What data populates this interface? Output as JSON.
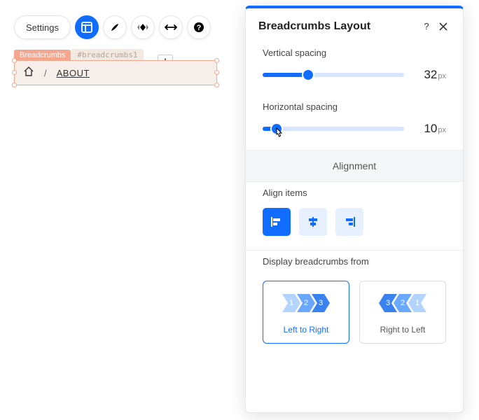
{
  "toolbar": {
    "settings_label": "Settings"
  },
  "element": {
    "badge_name": "Breadcrumbs",
    "badge_id": "#breadcrumbs1",
    "separator": "/",
    "current_label": "ABOUT"
  },
  "panel": {
    "title": "Breadcrumbs Layout",
    "vertical_spacing": {
      "label": "Vertical spacing",
      "value": "32",
      "unit": "px",
      "percent": 32
    },
    "horizontal_spacing": {
      "label": "Horizontal spacing",
      "value": "10",
      "unit": "px",
      "percent": 10
    },
    "alignment_heading": "Alignment",
    "align_items_label": "Align items",
    "display_label": "Display breadcrumbs from",
    "ltr": {
      "label": "Left to Right",
      "n1": "1",
      "n2": "2",
      "n3": "3"
    },
    "rtl": {
      "label": "Right to Left",
      "n1": "3",
      "n2": "2",
      "n3": "1"
    }
  }
}
